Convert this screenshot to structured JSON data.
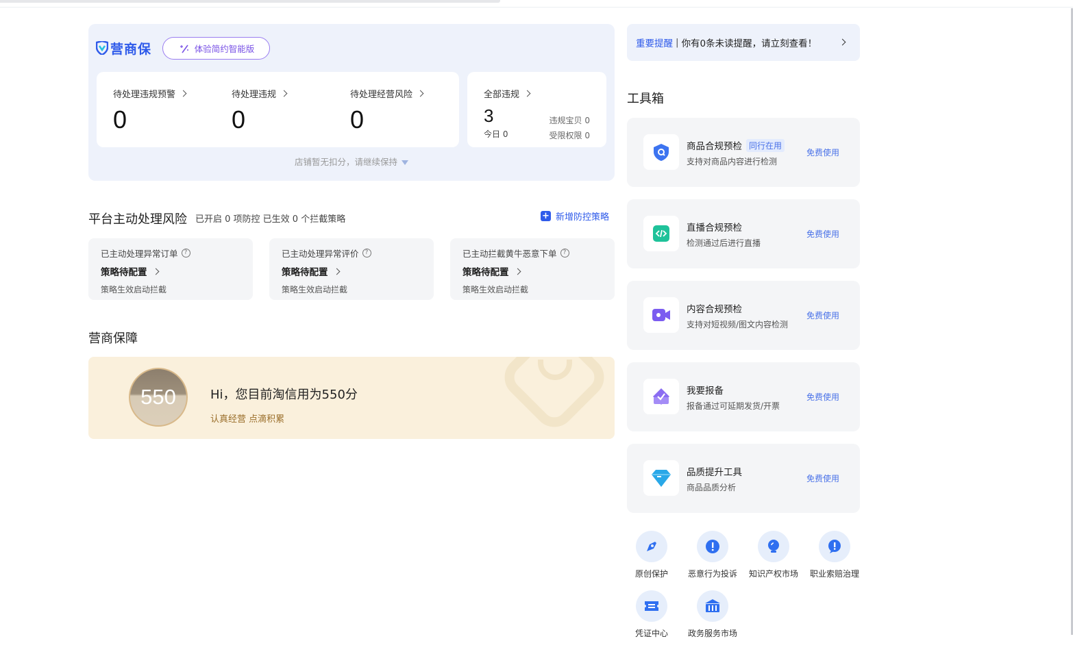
{
  "overview": {
    "logo_text": "营商保",
    "smart_button": "体验简约智能版",
    "stats": [
      {
        "label": "待处理违规预警",
        "value": "0"
      },
      {
        "label": "待处理违规",
        "value": "0"
      },
      {
        "label": "待处理经营风险",
        "value": "0"
      }
    ],
    "all_violations": {
      "label": "全部违规",
      "value": "3",
      "today_label": "今日",
      "today_value": "0",
      "items_label": "违规宝贝",
      "items_value": "0",
      "restrict_label": "受限权限",
      "restrict_value": "0"
    },
    "deduct_note": "店铺暂无扣分，请继续保持"
  },
  "platform_risk": {
    "title": "平台主动处理风险",
    "subtitle": "已开启 0 项防控 已生效 0 个拦截策略",
    "add_button": "新增防控策略",
    "cards": [
      {
        "label": "已主动处理异常订单",
        "link": "策略待配置",
        "desc": "策略生效启动拦截"
      },
      {
        "label": "已主动处理异常评价",
        "link": "策略待配置",
        "desc": "策略生效启动拦截"
      },
      {
        "label": "已主动拦截黄牛恶意下单",
        "link": "策略待配置",
        "desc": "策略生效启动拦截"
      }
    ]
  },
  "guarantee": {
    "title": "营商保障",
    "score": "550",
    "headline": "Hi，您目前淘信用为550分",
    "slogan": "认真经营 点滴积累"
  },
  "notice": {
    "highlight": "重要提醒",
    "separator": "|",
    "text": "你有0条未读提醒，请立刻查看！"
  },
  "toolbox": {
    "title": "工具箱",
    "tools": [
      {
        "name": "商品合规预检",
        "tag": "同行在用",
        "desc": "支持对商品内容进行检测",
        "action": "免费使用",
        "icon": "shield-search-icon"
      },
      {
        "name": "直播合规预检",
        "tag": "",
        "desc": "检测通过后进行直播",
        "action": "免费使用",
        "icon": "code-icon"
      },
      {
        "name": "内容合规预检",
        "tag": "",
        "desc": "支持对短视频/图文内容检测",
        "action": "免费使用",
        "icon": "video-icon"
      },
      {
        "name": "我要报备",
        "tag": "",
        "desc": "报备通过可延期发货/开票",
        "action": "免费使用",
        "icon": "check-diamond-icon"
      },
      {
        "name": "品质提升工具",
        "tag": "",
        "desc": "商品品质分析",
        "action": "免费使用",
        "icon": "gem-icon"
      }
    ],
    "quick": [
      {
        "label": "原创保护",
        "icon": "pen-icon"
      },
      {
        "label": "恶意行为投诉",
        "icon": "alert-icon"
      },
      {
        "label": "知识产权市场",
        "icon": "bulb-icon"
      },
      {
        "label": "职业索赔治理",
        "icon": "alert-bubble-icon"
      },
      {
        "label": "凭证中心",
        "icon": "ticket-icon"
      },
      {
        "label": "政务服务市场",
        "icon": "bank-icon"
      }
    ]
  },
  "colors": {
    "accent": "#2f5bea",
    "card_bg": "#eef2fb",
    "credit_bg": "#faf0dc"
  }
}
